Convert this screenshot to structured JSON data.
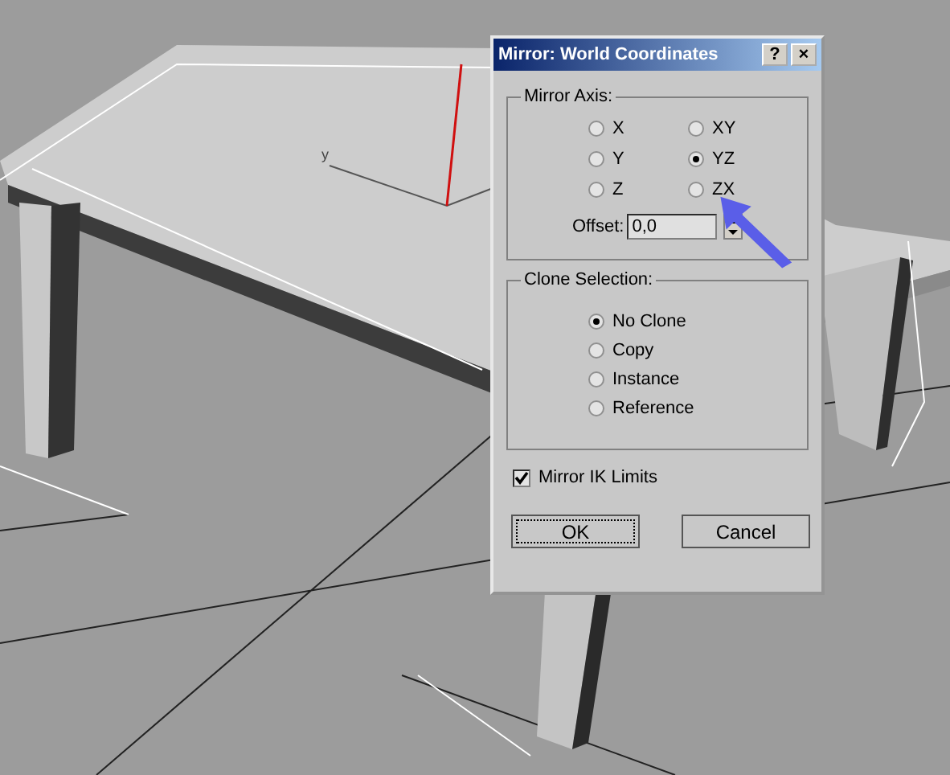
{
  "viewport": {
    "axis_label": "y"
  },
  "dialog": {
    "title": "Mirror: World Coordinates",
    "title_buttons": [
      "?",
      "×"
    ],
    "mirror_axis": {
      "label": "Mirror Axis:",
      "options": [
        {
          "label": "X",
          "selected": false
        },
        {
          "label": "XY",
          "selected": false
        },
        {
          "label": "Y",
          "selected": false
        },
        {
          "label": "YZ",
          "selected": true
        },
        {
          "label": "Z",
          "selected": false
        },
        {
          "label": "ZX",
          "selected": false
        }
      ],
      "offset": {
        "label": "Offset:",
        "value": "0,0"
      }
    },
    "clone_selection": {
      "label": "Clone Selection:",
      "options": [
        {
          "label": "No Clone",
          "selected": true
        },
        {
          "label": "Copy",
          "selected": false
        },
        {
          "label": "Instance",
          "selected": false
        },
        {
          "label": "Reference",
          "selected": false
        }
      ]
    },
    "mirror_ik_limits": {
      "label": "Mirror IK Limits",
      "checked": true
    },
    "buttons": [
      {
        "label": "OK",
        "focused": true
      },
      {
        "label": "Cancel",
        "focused": false
      }
    ]
  }
}
